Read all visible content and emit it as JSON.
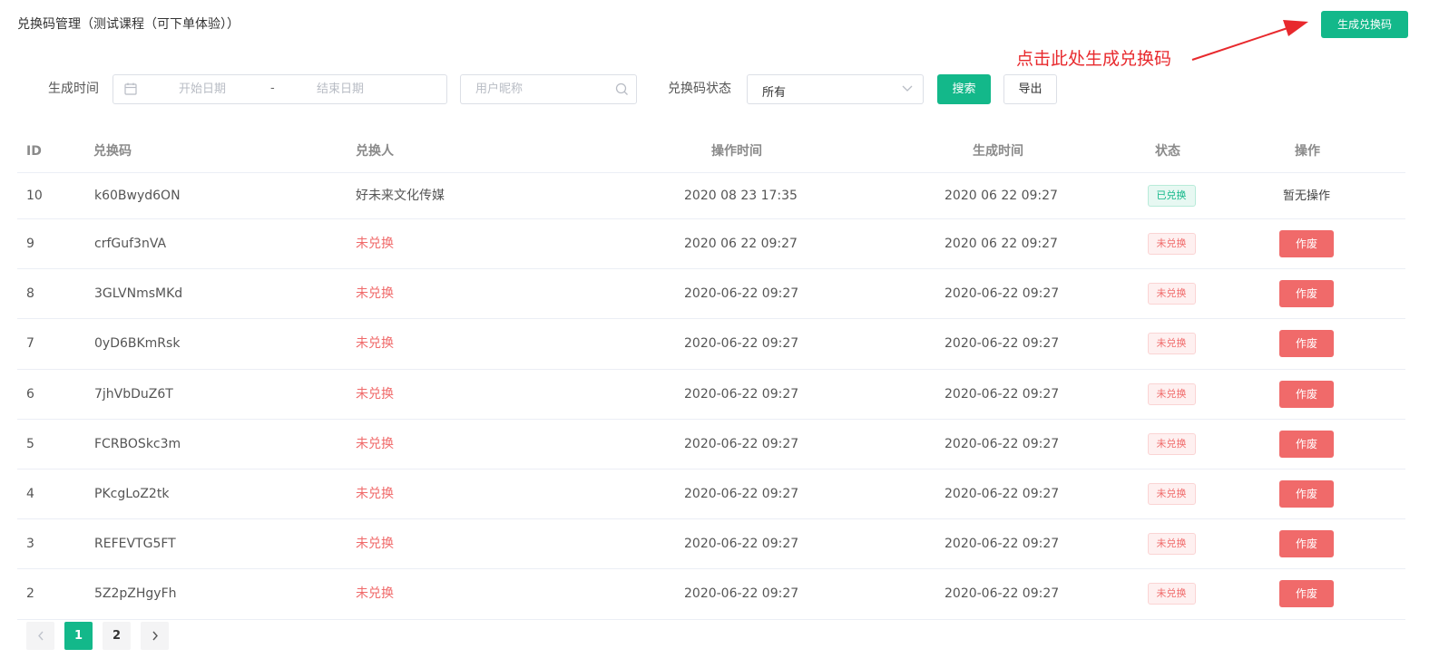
{
  "header": {
    "title": "兑换码管理（测试课程（可下单体验））",
    "generate_button": "生成兑换码",
    "annotation": "点击此处生成兑换码"
  },
  "filters": {
    "time_label": "生成时间",
    "start_placeholder": "开始日期",
    "range_separator": "-",
    "end_placeholder": "结束日期",
    "nickname_placeholder": "用户昵称",
    "status_label": "兑换码状态",
    "status_value": "所有",
    "search_button": "搜索",
    "export_button": "导出"
  },
  "table": {
    "headers": {
      "id": "ID",
      "code": "兑换码",
      "redeemer": "兑换人",
      "op_time": "操作时间",
      "gen_time": "生成时间",
      "status": "状态",
      "action": "操作"
    },
    "rows": [
      {
        "id": "10",
        "code": "k60Bwyd6ON",
        "redeemer": "好未来文化传媒",
        "op_time": "2020 08 23 17:35",
        "gen_time": "2020 06 22 09:27",
        "status": "已兑换",
        "action": "暂无操作"
      },
      {
        "id": "9",
        "code": "crfGuf3nVA",
        "redeemer": "未兑换",
        "op_time": "2020 06 22 09:27",
        "gen_time": "2020 06 22 09:27",
        "status": "未兑换",
        "action": "作废"
      },
      {
        "id": "8",
        "code": "3GLVNmsMKd",
        "redeemer": "未兑换",
        "op_time": "2020-06-22 09:27",
        "gen_time": "2020-06-22 09:27",
        "status": "未兑换",
        "action": "作废"
      },
      {
        "id": "7",
        "code": "0yD6BKmRsk",
        "redeemer": "未兑换",
        "op_time": "2020-06-22 09:27",
        "gen_time": "2020-06-22 09:27",
        "status": "未兑换",
        "action": "作废"
      },
      {
        "id": "6",
        "code": "7jhVbDuZ6T",
        "redeemer": "未兑换",
        "op_time": "2020-06-22 09:27",
        "gen_time": "2020-06-22 09:27",
        "status": "未兑换",
        "action": "作废"
      },
      {
        "id": "5",
        "code": "FCRBOSkc3m",
        "redeemer": "未兑换",
        "op_time": "2020-06-22 09:27",
        "gen_time": "2020-06-22 09:27",
        "status": "未兑换",
        "action": "作废"
      },
      {
        "id": "4",
        "code": "PKcgLoZ2tk",
        "redeemer": "未兑换",
        "op_time": "2020-06-22 09:27",
        "gen_time": "2020-06-22 09:27",
        "status": "未兑换",
        "action": "作废"
      },
      {
        "id": "3",
        "code": "REFEVTG5FT",
        "redeemer": "未兑换",
        "op_time": "2020-06-22 09:27",
        "gen_time": "2020-06-22 09:27",
        "status": "未兑换",
        "action": "作废"
      },
      {
        "id": "2",
        "code": "5Z2pZHgyFh",
        "redeemer": "未兑换",
        "op_time": "2020-06-22 09:27",
        "gen_time": "2020-06-22 09:27",
        "status": "未兑换",
        "action": "作废"
      }
    ]
  },
  "pagination": {
    "pages": [
      "1",
      "2"
    ],
    "current": "1"
  },
  "colors": {
    "primary": "#13b88a",
    "danger": "#f06a6a",
    "annotation": "#e8292d"
  }
}
